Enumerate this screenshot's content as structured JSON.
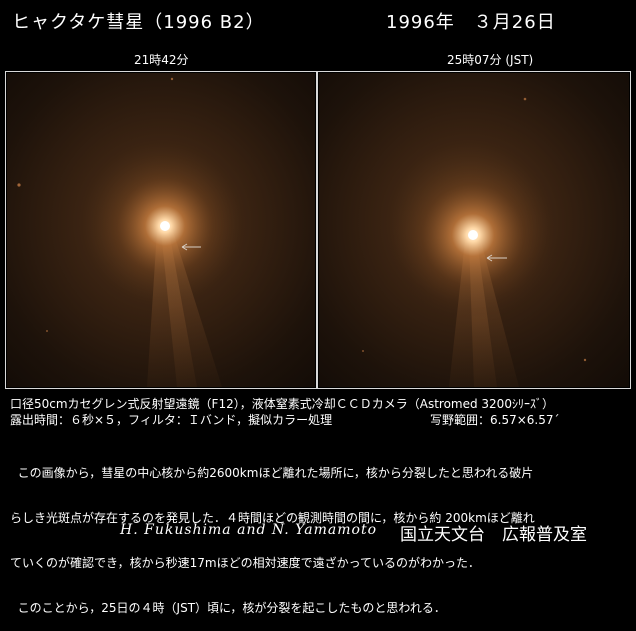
{
  "title": "ヒャクタケ彗星（1996 B2）",
  "date": "1996年　３月26日",
  "panels": [
    {
      "time": "21時42分"
    },
    {
      "time": "25時07分 (JST)"
    }
  ],
  "specs": {
    "line1": "口径50cmカセグレン式反射望遠鏡（F12），液体窒素式冷却ＣＣＤカメラ（Astromed 3200ｼﾘｰｽﾞ）",
    "line2": "露出時間：６秒×５，フィルタ：Ｉバンド，擬似カラー処理",
    "field": "写野範囲：6.57×6.57´"
  },
  "description": [
    "  この画像から，彗星の中心核から約2600kmほど離れた場所に，核から分裂したと思われる破片",
    "らしき光斑点が存在するのを発見した．４時間ほどの観測時間の間に，核から約 200kmほど離れ",
    "ていくのが確認でき，核から秒速17mほどの相対速度で遠ざかっているのがわかった．",
    "  このことから，25日の４時（JST）頃に，核が分裂を起こしたものと思われる．"
  ],
  "credits": {
    "authors": "H. Fukushima  and  N. Yamamoto",
    "organization": "国立天文台　広報普及室"
  }
}
